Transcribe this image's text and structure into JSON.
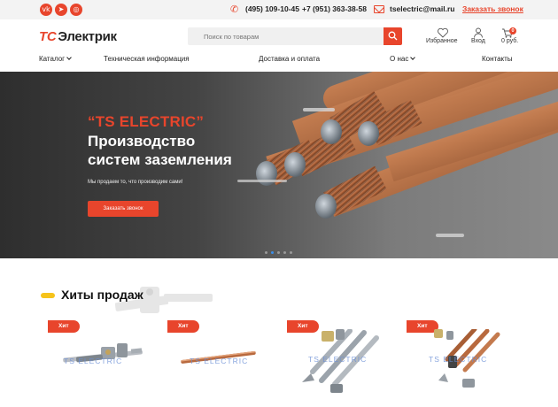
{
  "topbar": {
    "social": [
      {
        "icon": "vk-icon",
        "glyph": "vk"
      },
      {
        "icon": "telegram-icon",
        "glyph": "➤"
      },
      {
        "icon": "instagram-icon",
        "glyph": "◎"
      }
    ],
    "phone1": "(495) 109-10-45",
    "phone2": "+7 (951) 363-38-58",
    "email": "tselectric@mail.ru",
    "callback": "Заказать звонок"
  },
  "header": {
    "logo_prefix": "ТС",
    "logo_text": "Электрик",
    "search_placeholder": "Поиск по товарам",
    "favorites_label": "Избранное",
    "login_label": "Вход",
    "cart_label": "0 руб.",
    "cart_count": "0"
  },
  "nav": {
    "catalog": "Каталог",
    "tech": "Техническая информация",
    "delivery": "Доставка и оплата",
    "about": "О нас",
    "contacts": "Контакты"
  },
  "hero": {
    "quote": "“TS ELECTRIC”",
    "title_line1": "Производство",
    "title_line2": "систем заземления",
    "subtitle": "Мы продаем то, что производим сами!",
    "button": "Заказать звонок",
    "slides_total": 5,
    "slide_active": 2
  },
  "section": {
    "title": "Хиты продаж"
  },
  "products": [
    {
      "badge": "Хит",
      "brand": "TS ELECTRIC"
    },
    {
      "badge": "Хит",
      "brand": "TS ELECTRIC"
    },
    {
      "badge": "Хит",
      "brand": "TS ELECTRIC"
    },
    {
      "badge": "Хит",
      "brand": "TS ELECTRIC"
    }
  ],
  "colors": {
    "accent": "#e8452c",
    "section_accent": "#f6c31b",
    "copper": "#c07a4e"
  }
}
